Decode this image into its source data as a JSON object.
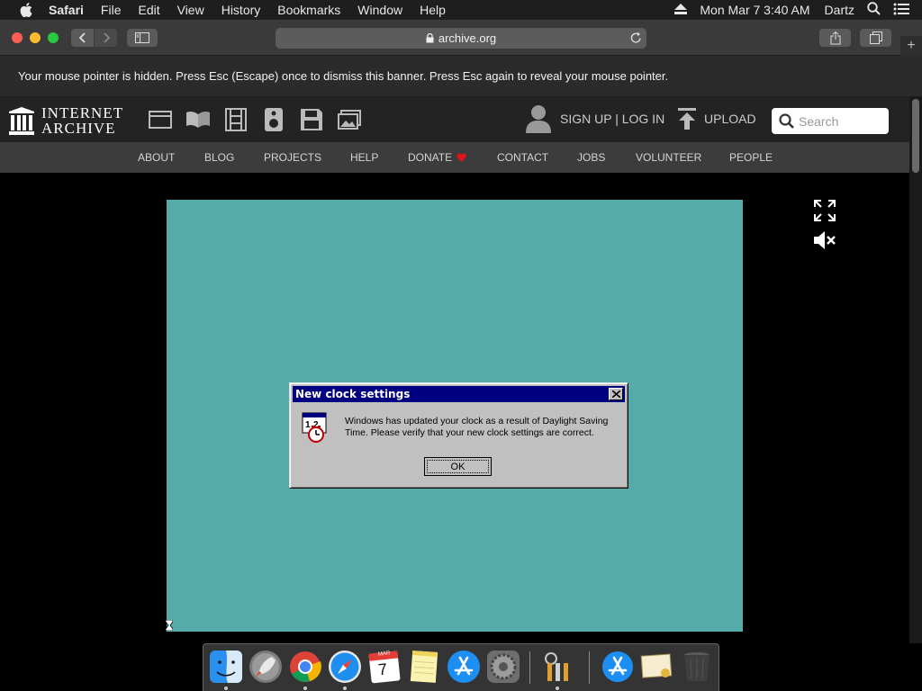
{
  "menubar": {
    "app_name": "Safari",
    "menus": [
      "File",
      "Edit",
      "View",
      "History",
      "Bookmarks",
      "Window",
      "Help"
    ],
    "clock": "Mon Mar 7  3:40 AM",
    "user": "Dartz"
  },
  "browser": {
    "url": "archive.org",
    "new_tab_symbol": "+"
  },
  "banner": {
    "text": "Your mouse pointer is hidden. Press Esc (Escape) once to dismiss this banner. Press Esc again to reveal your mouse pointer."
  },
  "ia_header": {
    "logo_line1": "INTERNET",
    "logo_line2": "ARCHIVE",
    "media_icons": [
      "web-icon",
      "texts-icon",
      "video-icon",
      "audio-icon",
      "software-icon",
      "images-icon"
    ],
    "signin": "SIGN UP | LOG IN",
    "upload": "UPLOAD",
    "search_placeholder": "Search"
  },
  "ia_nav": {
    "items": [
      "ABOUT",
      "BLOG",
      "PROJECTS",
      "HELP",
      "DONATE",
      "CONTACT",
      "JOBS",
      "VOLUNTEER",
      "PEOPLE"
    ]
  },
  "emulator": {
    "screen_color": "#55aaaa",
    "dialog": {
      "title": "New clock settings",
      "message": "Windows has updated your clock as a result of Daylight Saving Time.  Please verify that your new clock settings are correct.",
      "ok_label": "OK"
    }
  },
  "dock": {
    "apps": [
      "finder-icon",
      "launchpad-icon",
      "chrome-icon",
      "safari-icon",
      "calendar-icon",
      "notes-icon",
      "app-store-icon",
      "system-preferences-icon",
      "keychain-icon",
      "app-store-folder-icon",
      "certificate-icon",
      "trash-icon"
    ],
    "calendar_month": "MAR",
    "calendar_day": "7"
  },
  "colors": {
    "accent_red": "#fd5f57",
    "win95_title": "#000080",
    "teal_desktop": "#55aaaa"
  }
}
